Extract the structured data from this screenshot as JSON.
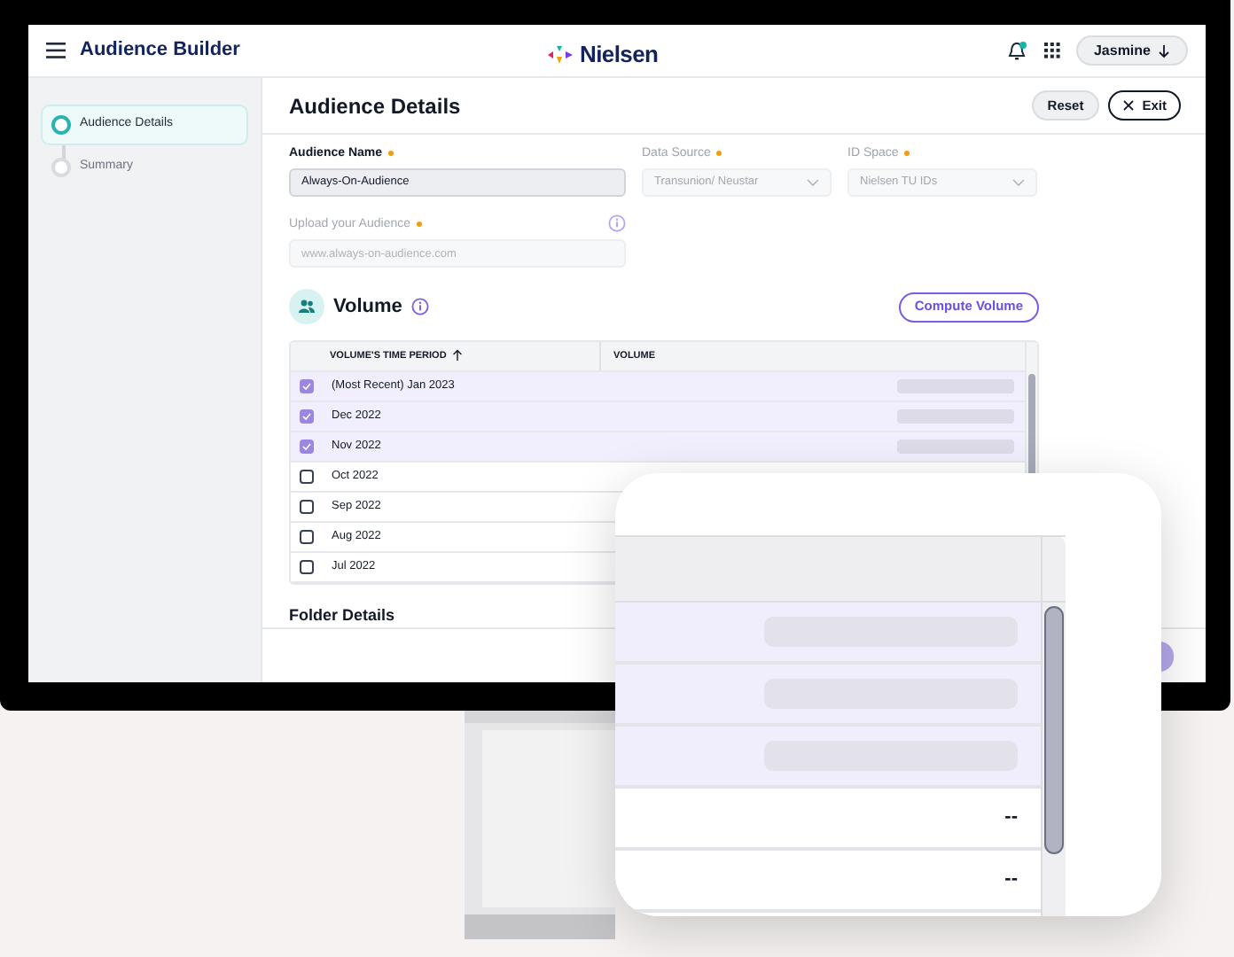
{
  "app": {
    "title": "Audience Builder",
    "logo": "Nielsen",
    "user": "Jasmine",
    "notification": true
  },
  "steps": [
    {
      "label": "Audience Details",
      "selected": true
    },
    {
      "label": "Summary",
      "selected": false
    }
  ],
  "page": {
    "title": "Audience Details",
    "buttons": [
      {
        "label": "Reset",
        "kind": "secondary"
      },
      {
        "label": "Exit",
        "kind": "exit"
      }
    ]
  },
  "fields": [
    {
      "label": "Audience Name",
      "required": true,
      "value": "Always-On-Audience",
      "kind": "text",
      "disabled": false
    },
    {
      "label": "Data Source",
      "required": true,
      "value": "Transunion/ Neustar",
      "kind": "select",
      "disabled": true
    },
    {
      "label": "ID Space",
      "required": true,
      "value": "Nielsen TU IDs",
      "kind": "select",
      "disabled": true
    }
  ],
  "upload": {
    "label": "Upload your Audience",
    "required": true,
    "placeholder": "www.always-on-audience.com",
    "disabled": true
  },
  "volume": {
    "title": "Volume",
    "action": "Compute Volume",
    "columns": [
      "VOLUME'S TIME PERIOD",
      "VOLUME"
    ],
    "rows": [
      {
        "period": "(Most Recent) Jan 2023",
        "checked": true
      },
      {
        "period": "Dec 2022",
        "checked": true
      },
      {
        "period": "Nov 2022",
        "checked": true
      },
      {
        "period": "Oct 2022",
        "checked": false
      },
      {
        "period": "Sep 2022",
        "checked": false
      },
      {
        "period": "Aug 2022",
        "checked": false
      },
      {
        "period": "Jul 2022",
        "checked": false
      }
    ]
  },
  "section_heading": "Folder Details",
  "callout": {
    "rows": [
      {
        "selected": true,
        "kind": "loading"
      },
      {
        "selected": true,
        "kind": "loading"
      },
      {
        "selected": true,
        "kind": "loading"
      },
      {
        "selected": false,
        "kind": "value",
        "value": "--"
      },
      {
        "selected": false,
        "kind": "value",
        "value": "--"
      }
    ]
  }
}
